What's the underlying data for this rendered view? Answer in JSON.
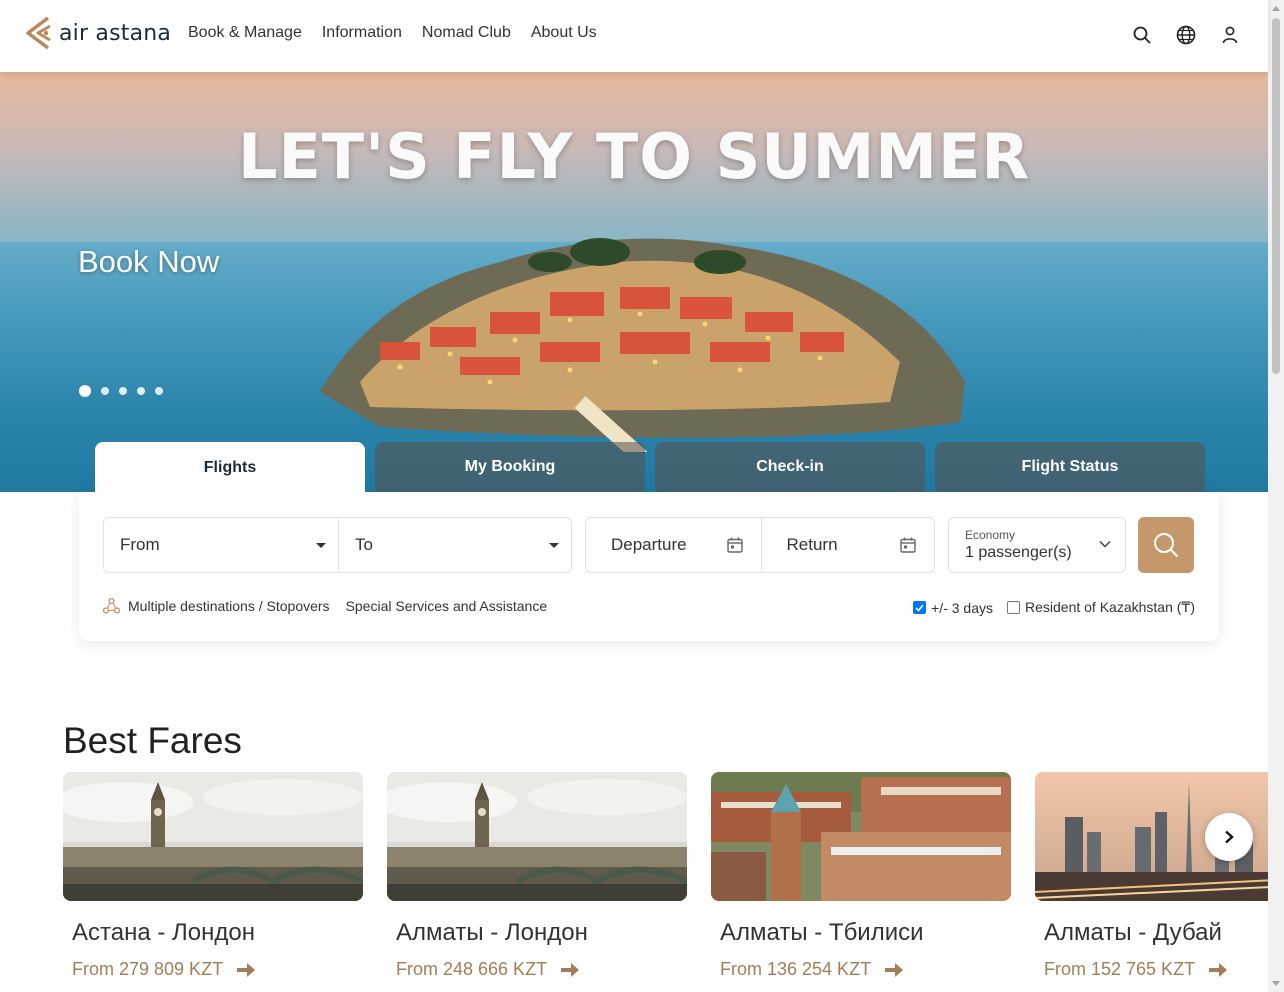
{
  "header": {
    "logo_text": "air astana",
    "nav": [
      "Book & Manage",
      "Information",
      "Nomad Club",
      "About Us"
    ],
    "icons": [
      "search-icon",
      "globe-icon",
      "user-icon"
    ]
  },
  "hero": {
    "headline": "LET'S FLY TO SUMMER",
    "cta": "Book Now",
    "slides_count": 5,
    "active_slide": 1
  },
  "booking": {
    "tabs": [
      "Flights",
      "My Booking",
      "Check-in",
      "Flight Status"
    ],
    "active_tab": "Flights",
    "from_placeholder": "From",
    "to_placeholder": "To",
    "departure_placeholder": "Departure",
    "return_placeholder": "Return",
    "cabin_class": "Economy",
    "passengers": "1 passenger(s)",
    "multi_link": "Multiple destinations / Stopovers",
    "services_link": "Special Services and Assistance",
    "flex_days_label": "+/- 3 days",
    "flex_days_checked": true,
    "resident_label": "Resident of Kazakhstan (₸)",
    "resident_checked": false
  },
  "fares": {
    "title": "Best Fares",
    "items": [
      {
        "route": "Астана - Лондон",
        "price": "From 279 809 KZT",
        "image": "london"
      },
      {
        "route": "Алматы - Лондон",
        "price": "From 248 666 KZT",
        "image": "london"
      },
      {
        "route": "Алматы - Тбилиси",
        "price": "From 136 254 KZT",
        "image": "tbilisi"
      },
      {
        "route": "Алматы - Дубай",
        "price": "From 152 765 KZT",
        "image": "dubai"
      }
    ]
  },
  "colors": {
    "accent": "#c4986a",
    "price": "#a27e58",
    "text_dark": "#1e2a39"
  }
}
